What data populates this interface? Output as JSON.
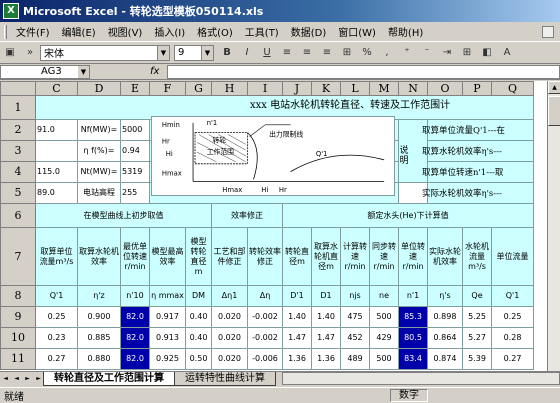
{
  "window": {
    "title": "Microsoft Excel - 转轮选型模板050114.xls"
  },
  "menu": [
    "文件(F)",
    "编辑(E)",
    "视图(V)",
    "插入(I)",
    "格式(O)",
    "工具(T)",
    "数据(D)",
    "窗口(W)",
    "帮助(H)"
  ],
  "toolbar": {
    "font": "宋体",
    "size": "9",
    "bold": "B",
    "italic": "I",
    "underline": "U"
  },
  "formula": {
    "cell": "AG3",
    "fx": "fx",
    "value": ""
  },
  "columns": [
    "C",
    "D",
    "E",
    "F",
    "G",
    "H",
    "I",
    "J",
    "K",
    "L",
    "M",
    "N",
    "O",
    "P",
    "Q"
  ],
  "rows": [
    "1",
    "2",
    "3",
    "4",
    "5",
    "6",
    "7",
    "8",
    "9",
    "10",
    "11"
  ],
  "sheet": {
    "title": "xxx 电站水轮机转轮直径、转速及工作范围计",
    "params": {
      "r2": {
        "c": "91.0",
        "d": "Nf(MW)=",
        "e": "5000"
      },
      "r3": {
        "d": "η f(%)=",
        "e": "0.94"
      },
      "r4": {
        "c": "115.0",
        "d": "Nt(MW)=",
        "e": "5319"
      },
      "r5": {
        "c": "89.0",
        "d": "电站高程",
        "e": "255"
      }
    },
    "diagram": {
      "hmax": "Hmax",
      "hr": "Hr",
      "hi": "Hi",
      "hmin": "Hmin",
      "n1": "n'1",
      "tl": "转轮",
      "zy": "工作范围",
      "cl": "出力限制线",
      "q1": "Q'1",
      "ax_hmax": "Hmax",
      "ax_hi": "Hi",
      "ax_hr": "Hr"
    },
    "explain": "说明",
    "right": [
      "取算单位流量Q'1---在",
      "取算水轮机效率η's---",
      "取算单位转速n'1---取",
      "实际水轮机效率η's---"
    ],
    "sections": {
      "s1": "在模型曲线上初步取值",
      "s2": "效率修正",
      "s3": "额定水头(He)下计算值"
    },
    "heads": [
      "取算单位流量m³/s",
      "取算水轮机效率",
      "最优单位转速r/min",
      "模型最高效率",
      "模型转轮直径m",
      "工艺和部件修正",
      "转轮效率修正",
      "转轮直径m",
      "取算水轮机直径m",
      "计算转速r/min",
      "同步转速r/min",
      "单位转速r/min",
      "实际水轮机效率",
      "水轮机流量m³/s",
      "单位流量"
    ],
    "syms": [
      "Q'1",
      "η'z",
      "n'10",
      "η mmax",
      "DM",
      "Δη1",
      "Δη",
      "D'1",
      "D1",
      "njs",
      "ne",
      "n'1",
      "η's",
      "Qe",
      "Q'1"
    ],
    "data": [
      [
        "0.25",
        "0.900",
        "82.0",
        "0.917",
        "0.40",
        "0.020",
        "-0.002",
        "1.40",
        "1.40",
        "475",
        "500",
        "85.3",
        "0.898",
        "5.25",
        "0.25"
      ],
      [
        "0.23",
        "0.885",
        "82.0",
        "0.913",
        "0.40",
        "0.020",
        "-0.002",
        "1.47",
        "1.47",
        "452",
        "429",
        "80.5",
        "0.864",
        "5.27",
        "0.28"
      ],
      [
        "0.27",
        "0.880",
        "82.0",
        "0.925",
        "0.50",
        "0.020",
        "-0.006",
        "1.36",
        "1.36",
        "489",
        "500",
        "83.4",
        "0.874",
        "5.39",
        "0.27"
      ]
    ]
  },
  "tabs": [
    "转轮直径及工作范围计算",
    "运转特性曲线计算"
  ],
  "status": {
    "left": "就绪",
    "num": "数字"
  }
}
